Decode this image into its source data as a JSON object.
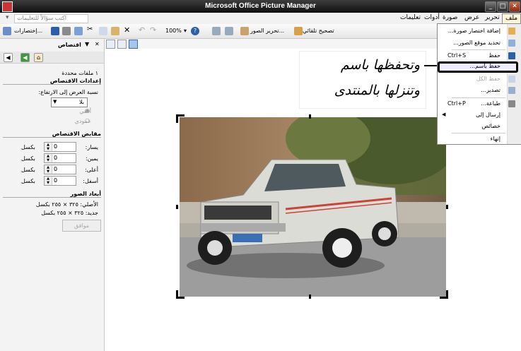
{
  "window": {
    "title": "Microsoft Office Picture Manager"
  },
  "menubar": {
    "file": "ملف",
    "edit": "تحرير",
    "view": "عرض",
    "picture": "صورة",
    "tools": "أدوات",
    "help": "تعليمات",
    "help_box": "اكتب سؤالاً للتعليمات"
  },
  "toolbar": {
    "shortcuts": "إختصارات...",
    "edit_pictures": "تحرير الصور...",
    "auto_correct": "تصحيح تلقائي",
    "zoom": "100%"
  },
  "pane": {
    "title": "اقتصاص",
    "selected_files": "١ ملفات محددة",
    "crop_settings": "إعدادات الاقتصاص",
    "aspect_label": "نسبة العرض إلى الارتفاع:",
    "aspect_value": "بلا",
    "landscape": "أفقي",
    "portrait": "عمودي",
    "handles": "مقابض الاقتصاص",
    "left": "يسار:",
    "right": "يمين:",
    "top": "أعلى:",
    "bottom": "أسفل:",
    "unit": "بكسل",
    "left_val": "0",
    "right_val": "0",
    "top_val": "0",
    "bottom_val": "0",
    "dimensions": "أبعاد الصور",
    "original": "الأصلي: ٣٢٥ × ٢٥٥ بكسل",
    "new": "جديد: ٣٢٥ × ٢٥٥ بكسل",
    "ok": "موافق"
  },
  "annotation": {
    "line1": "وتحفظها باسم",
    "line2": "وتنزلها بالمنتدى"
  },
  "file_menu": {
    "add_shortcut": "إضافة اختصار صورة...",
    "locate": "تحديد موقع الصور...",
    "save": "حفظ",
    "save_shortcut": "Ctrl+S",
    "save_as": "حفظ باسم...",
    "save_all": "حفظ الكل",
    "export": "تصدير...",
    "print": "طباعة...",
    "print_shortcut": "Ctrl+P",
    "send_to": "إرسال إلى",
    "properties": "خصائص",
    "exit": "إنهاء"
  },
  "colors": {
    "titlebar": "#1f1f1f",
    "menu_highlight": "#fdf6d8",
    "accent": "#2b5fa8"
  }
}
